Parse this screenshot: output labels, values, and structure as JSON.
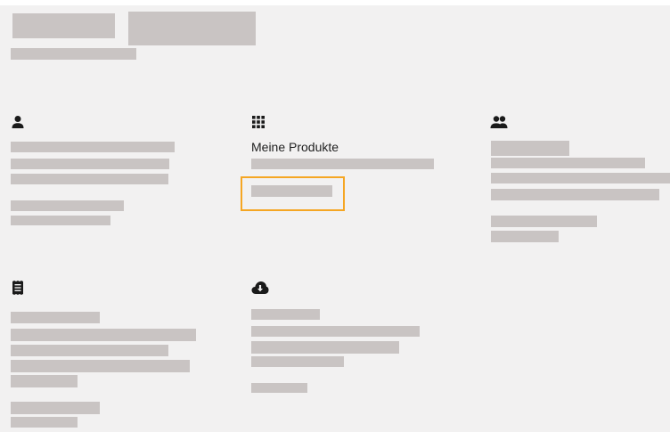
{
  "colors": {
    "page_background": "#f2f1f1",
    "placeholder": "#c9c4c3",
    "focus_outline": "#f5a623",
    "icon": "#1a1a1a"
  },
  "cards": {
    "profile": {
      "icon": "person-icon"
    },
    "products": {
      "icon": "grid-icon",
      "title": "Meine Produkte"
    },
    "users": {
      "icon": "people-icon"
    },
    "invoices": {
      "icon": "receipt-icon"
    },
    "downloads": {
      "icon": "cloud-download-icon"
    }
  }
}
